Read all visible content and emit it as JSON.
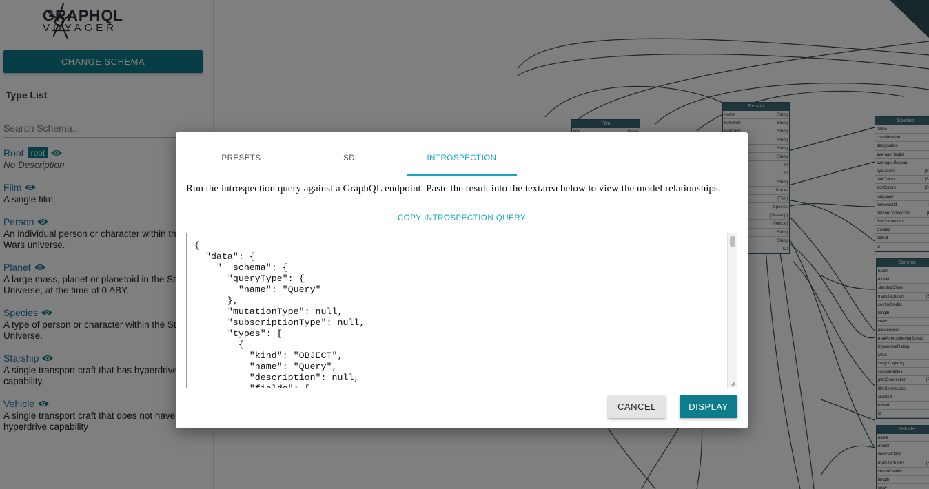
{
  "sidebar": {
    "logo": {
      "line1": "GRAPHQL",
      "line2": "VOYAGER"
    },
    "change_schema_label": "CHANGE SCHEMA",
    "type_list_title": "Type List",
    "search_placeholder": "Search Schema...",
    "root": {
      "name": "Root",
      "badge": "root",
      "description": "No Description"
    },
    "types": [
      {
        "name": "Film",
        "description": "A single film."
      },
      {
        "name": "Person",
        "description": "An individual person or character within the Star Wars universe."
      },
      {
        "name": "Planet",
        "description": "A large mass, planet or planetoid in the Star Wars Universe, at the time of 0 ABY."
      },
      {
        "name": "Species",
        "description": "A type of person or character within the Star Wars Universe."
      },
      {
        "name": "Starship",
        "description": "A single transport craft that has hyperdrive capability."
      },
      {
        "name": "Vehicle",
        "description": "A single transport craft that does not have hyperdrive capability"
      }
    ]
  },
  "graph": {
    "nodes": {
      "film": {
        "title": "Film",
        "rows": [
          [
            "title",
            "String"
          ]
        ]
      },
      "person": {
        "title": "Person",
        "rows": [
          [
            "name",
            "String"
          ],
          [
            "birthYear",
            "String"
          ],
          [
            "eyeColor",
            "String"
          ],
          [
            "",
            "String"
          ],
          [
            "",
            "String"
          ],
          [
            "",
            "String"
          ],
          [
            "",
            "Int"
          ],
          [
            "",
            "Int"
          ],
          [
            "",
            "String"
          ],
          [
            "",
            "Planet"
          ],
          [
            "nection",
            "[Film]"
          ],
          [
            "",
            "Species"
          ],
          [
            "ection",
            "[Starship]"
          ],
          [
            "ction",
            "[Vehicle]"
          ],
          [
            "",
            "String"
          ],
          [
            "",
            "String"
          ],
          [
            "",
            "ID!"
          ]
        ]
      },
      "species": {
        "title": "Species",
        "rows": [
          [
            "name",
            "Str"
          ],
          [
            "classification",
            "Str"
          ],
          [
            "designation",
            "Str"
          ],
          [
            "averageHeight",
            "Fl"
          ],
          [
            "averageLifespan",
            ""
          ],
          [
            "eyeColors",
            "[Strin"
          ],
          [
            "hairColors",
            "[Strin"
          ],
          [
            "skinColors",
            "[Strin"
          ],
          [
            "language",
            "Str"
          ],
          [
            "homeworld",
            "Pla"
          ],
          [
            "personConnection",
            "[Per"
          ],
          [
            "filmConnection",
            "[Fi"
          ],
          [
            "created",
            "Str"
          ],
          [
            "edited",
            "Str"
          ],
          [
            "id",
            ""
          ]
        ]
      },
      "starship": {
        "title": "Starship",
        "rows": [
          [
            "name",
            "Stri"
          ],
          [
            "model",
            "Stri"
          ],
          [
            "starshipClass",
            "Stri"
          ],
          [
            "manufacturers",
            "[Strin"
          ],
          [
            "costInCredits",
            "Flo"
          ],
          [
            "length",
            "Flo"
          ],
          [
            "crew",
            "Stri"
          ],
          [
            "passengers",
            "Stri"
          ],
          [
            "maxAtmospheringSpeed",
            "I"
          ],
          [
            "hyperdriveRating",
            "Flo"
          ],
          [
            "MGLT",
            ""
          ],
          [
            "cargoCapacity",
            "Flo"
          ],
          [
            "consumables",
            "Stri"
          ],
          [
            "pilotConnection",
            "[Pers"
          ],
          [
            "filmConnection",
            "[Fil"
          ],
          [
            "created",
            "Stri"
          ],
          [
            "edited",
            "Stri"
          ],
          [
            "id",
            ""
          ]
        ]
      },
      "vehicle": {
        "title": "Vehicle",
        "rows": [
          [
            "name",
            "Stri"
          ],
          [
            "model",
            "Stri"
          ],
          [
            "vehicleClass",
            "Stri"
          ],
          [
            "manufacturers",
            "[Strin"
          ],
          [
            "costInCredits",
            ""
          ],
          [
            "length",
            "Flo"
          ],
          [
            "crew",
            "Stri"
          ]
        ]
      }
    }
  },
  "modal": {
    "tabs": [
      {
        "label": "PRESETS",
        "active": false
      },
      {
        "label": "SDL",
        "active": false
      },
      {
        "label": "INTROSPECTION",
        "active": true
      }
    ],
    "intro_text": "Run the introspection query against a GraphQL endpoint. Paste the result into the textarea below to view the model relationships.",
    "copy_query_label": "COPY INTROSPECTION QUERY",
    "textarea_lines": [
      "{",
      "  \"data\": {",
      "    \"__schema\": {",
      "      \"queryType\": {",
      "        \"name\": \"Query\"",
      "      },",
      "      \"mutationType\": null,",
      "      \"subscriptionType\": null,",
      "      \"types\": [",
      "        {",
      "          \"kind\": \"OBJECT\",",
      "          \"name\": \"Query\",",
      "          \"description\": null,",
      "          \"fields\": ["
    ],
    "cancel_label": "CANCEL",
    "display_label": "DISPLAY"
  },
  "colors": {
    "accent": "#0e7d8b",
    "link": "#12a7c1",
    "type_name": "#1b6fa8",
    "node_header": "#3c6b77"
  }
}
